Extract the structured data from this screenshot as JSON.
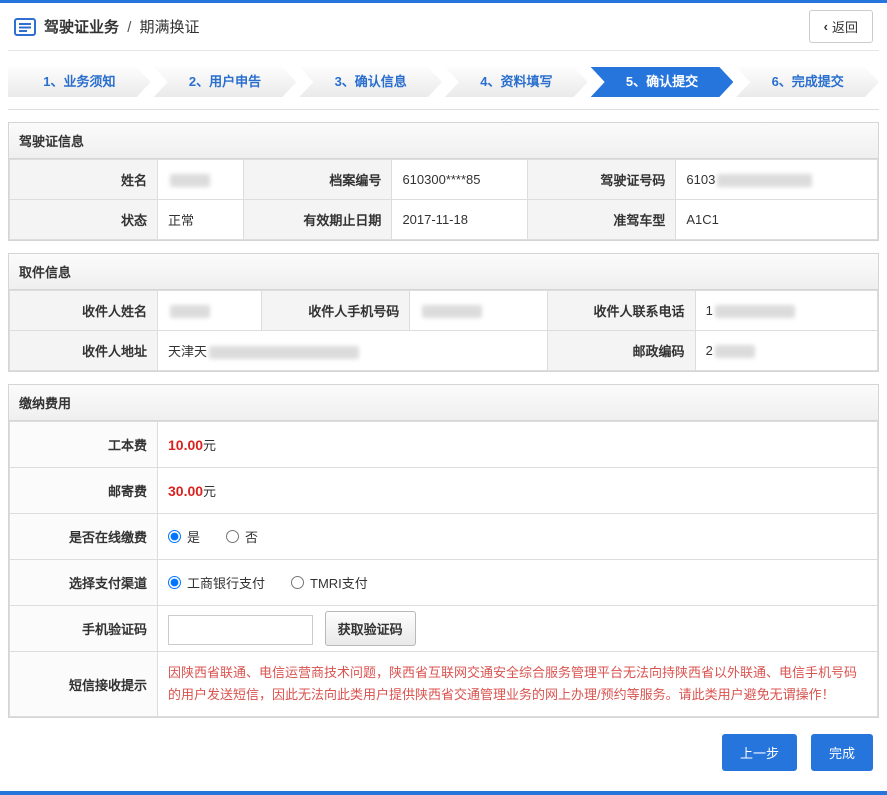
{
  "header": {
    "title_main": "驾驶证业务",
    "title_divider": "/",
    "title_sub": "期满换证",
    "back_chevron": "‹",
    "back_label": "返回"
  },
  "steps": {
    "s1": "1、业务须知",
    "s2": "2、用户申告",
    "s3": "3、确认信息",
    "s4": "4、资料填写",
    "s5": "5、确认提交",
    "s6": "6、完成提交",
    "active_step": "5、确认提交"
  },
  "license_info": {
    "title": "驾驶证信息",
    "name_label": "姓名",
    "name_value": "",
    "file_no_label": "档案编号",
    "file_no_value": "610300****85",
    "license_no_label": "驾驶证号码",
    "license_no_value": "6103",
    "status_label": "状态",
    "status_value": "正常",
    "expiry_label": "有效期止日期",
    "expiry_value": "2017-11-18",
    "vehicle_class_label": "准驾车型",
    "vehicle_class_value": "A1C1"
  },
  "pickup_info": {
    "title": "取件信息",
    "recipient_name_label": "收件人姓名",
    "recipient_name_value": "",
    "recipient_phone_label": "收件人手机号码",
    "recipient_phone_value": "",
    "recipient_tel_label": "收件人联系电话",
    "recipient_tel_value": "1",
    "address_label": "收件人地址",
    "address_value": "天津天",
    "postcode_label": "邮政编码",
    "postcode_value": "2"
  },
  "fees": {
    "title": "缴纳费用",
    "fee1_label": "工本费",
    "fee1_amount": "10.00",
    "fee1_unit": "元",
    "fee2_label": "邮寄费",
    "fee2_amount": "30.00",
    "fee2_unit": "元",
    "online_label": "是否在线缴费",
    "online_yes": "是",
    "online_yes_checked": true,
    "online_no": "否",
    "channel_label": "选择支付渠道",
    "channel_icbc": "工商银行支付",
    "channel_icbc_checked": true,
    "channel_tmri": "TMRI支付",
    "captcha_label": "手机验证码",
    "captcha_value": "",
    "captcha_button": "获取验证码",
    "notice_label": "短信接收提示",
    "notice_text": "因陕西省联通、电信运营商技术问题，陕西省互联网交通安全综合服务管理平台无法向持陕西省以外联通、电信手机号码的用户发送短信，因此无法向此类用户提供陕西省交通管理业务的网上办理/预约等服务。请此类用户避免无谓操作！"
  },
  "footer": {
    "prev_label": "上一步",
    "done_label": "完成"
  },
  "colors": {
    "primary_blue": "#2575dd",
    "step_text_blue": "#2a6fce",
    "amount_red": "#d9231f",
    "notice_red": "#d9534f"
  }
}
